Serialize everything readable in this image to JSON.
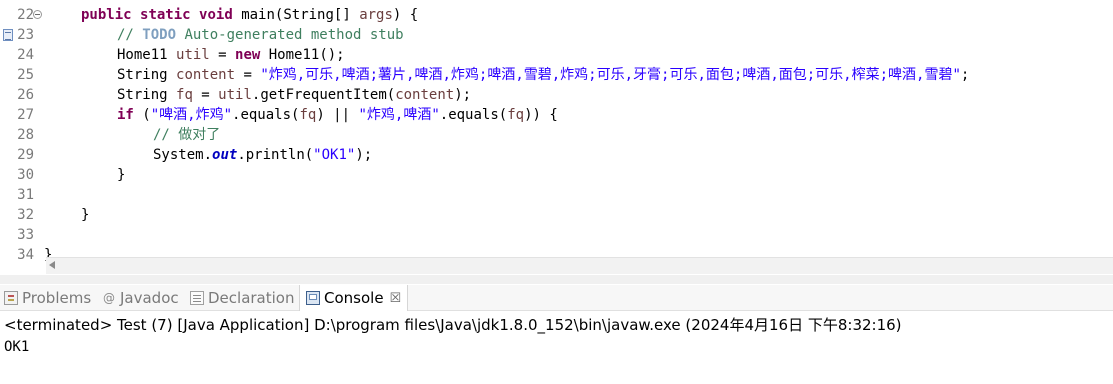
{
  "editor": {
    "lines": [
      {
        "num": "22",
        "marker": "fold"
      },
      {
        "num": "23",
        "marker": "task"
      },
      {
        "num": "24"
      },
      {
        "num": "25"
      },
      {
        "num": "26"
      },
      {
        "num": "27"
      },
      {
        "num": "28"
      },
      {
        "num": "29"
      },
      {
        "num": "30"
      },
      {
        "num": "31"
      },
      {
        "num": "32"
      },
      {
        "num": "33"
      },
      {
        "num": "34"
      }
    ],
    "code": {
      "l22_public": "public",
      "l22_static": "static",
      "l22_void": "void",
      "l22_rest": "main(String[] ",
      "l22_args": "args",
      "l22_end": ") {",
      "l23_prefix": "// ",
      "l23_todo": "TODO",
      "l23_rest": " Auto-generated method stub",
      "l24_type": "Home11 ",
      "l24_var": "util",
      "l24_eq": " = ",
      "l24_new": "new",
      "l24_rest": " Home11();",
      "l25_type": "String ",
      "l25_var": "content",
      "l25_eq": " = ",
      "l25_str": "\"炸鸡,可乐,啤酒;薯片,啤酒,炸鸡;啤酒,雪碧,炸鸡;可乐,牙膏;可乐,面包;啤酒,面包;可乐,榨菜;啤酒,雪碧\"",
      "l25_end": ";",
      "l26_type": "String ",
      "l26_var": "fq",
      "l26_eq": " = ",
      "l26_var2": "util",
      "l26_call": ".getFrequentItem(",
      "l26_arg": "content",
      "l26_end": ");",
      "l27_if": "if",
      "l27_open": " (",
      "l27_str1": "\"啤酒,炸鸡\"",
      "l27_eq1": ".equals(",
      "l27_fq1": "fq",
      "l27_or": ") || ",
      "l27_str2": "\"炸鸡,啤酒\"",
      "l27_eq2": ".equals(",
      "l27_fq2": "fq",
      "l27_end": ")) {",
      "l28_comment": "// 做对了",
      "l29_sys": "System.",
      "l29_out": "out",
      "l29_call": ".println(",
      "l29_str": "\"OK1\"",
      "l29_end": ");",
      "l30": "}",
      "l32": "}",
      "l34": "}"
    }
  },
  "views": {
    "tabs": [
      {
        "label": "Problems",
        "icon": "problems-icon",
        "active": false
      },
      {
        "label": "Javadoc",
        "icon": "javadoc-icon",
        "glyph": "@",
        "active": false
      },
      {
        "label": "Declaration",
        "icon": "declaration-icon",
        "active": false
      },
      {
        "label": "Console",
        "icon": "console-icon",
        "active": true,
        "close": "☒"
      }
    ],
    "console": {
      "status": "<terminated> Test (7) [Java Application] D:\\program files\\Java\\jdk1.8.0_152\\bin\\javaw.exe (2024年4月16日 下午8:32:16)",
      "output": "OK1"
    }
  },
  "colors": {
    "keyword": "#7f0055",
    "comment": "#3f7f5f",
    "string": "#2a00ff",
    "local_variable": "#6a3e3e",
    "static_field": "#0000c0",
    "todo": "#7f9fbf"
  }
}
